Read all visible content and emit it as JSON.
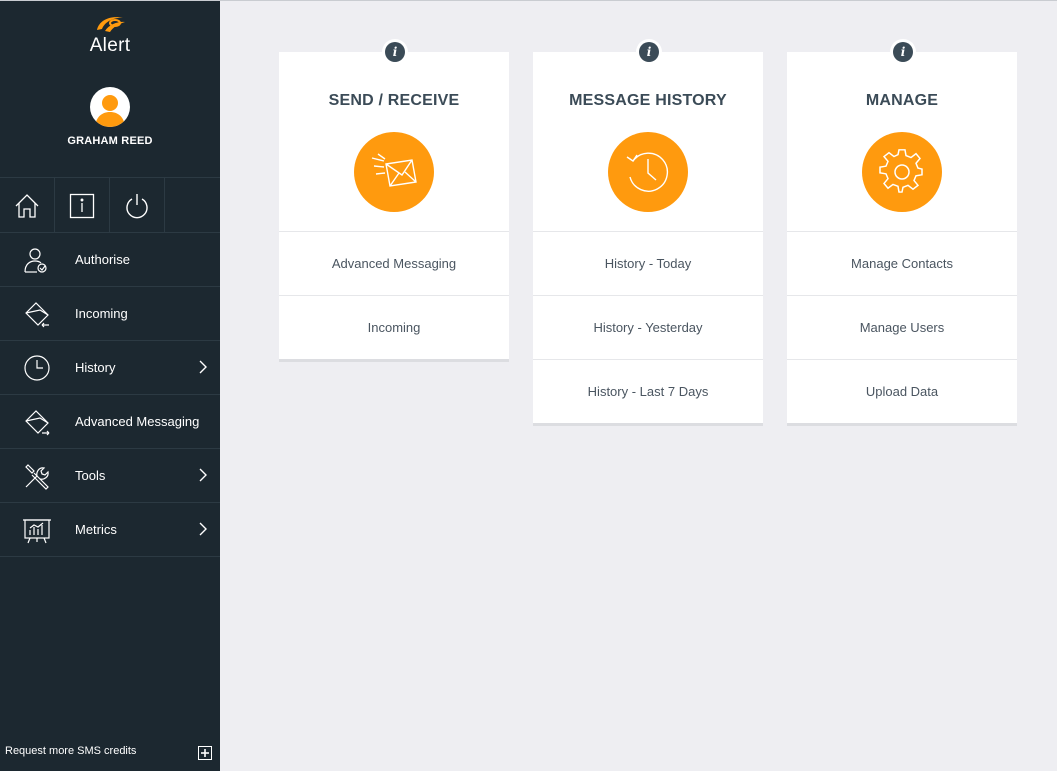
{
  "sidebar": {
    "logo_text": "Alert",
    "username": "GRAHAM REED",
    "quick_actions": [
      {
        "icon": "home-icon"
      },
      {
        "icon": "info-icon"
      },
      {
        "icon": "power-icon"
      }
    ],
    "items": [
      {
        "label": "Authorise",
        "icon": "user-check-icon",
        "has_submenu": false
      },
      {
        "label": "Incoming",
        "icon": "incoming-envelope-icon",
        "has_submenu": false
      },
      {
        "label": "History",
        "icon": "clock-icon",
        "has_submenu": true
      },
      {
        "label": "Advanced Messaging",
        "icon": "outgoing-envelope-icon",
        "has_submenu": false
      },
      {
        "label": "Tools",
        "icon": "tools-icon",
        "has_submenu": true
      },
      {
        "label": "Metrics",
        "icon": "metrics-board-icon",
        "has_submenu": true
      }
    ],
    "footer_text": "Request more SMS credits"
  },
  "cards": [
    {
      "title": "SEND / RECEIVE",
      "icon": "envelope-icon",
      "links": [
        "Advanced Messaging",
        "Incoming"
      ]
    },
    {
      "title": "MESSAGE HISTORY",
      "icon": "history-clock-icon",
      "links": [
        "History - Today",
        "History - Yesterday",
        "History - Last 7 Days"
      ]
    },
    {
      "title": "MANAGE",
      "icon": "gear-icon",
      "links": [
        "Manage Contacts",
        "Manage Users",
        "Upload Data"
      ]
    }
  ],
  "colors": {
    "sidebar_bg": "#1c2830",
    "accent": "#ff9a0e",
    "title": "#3b4b57",
    "content_bg": "#eeeef2"
  }
}
